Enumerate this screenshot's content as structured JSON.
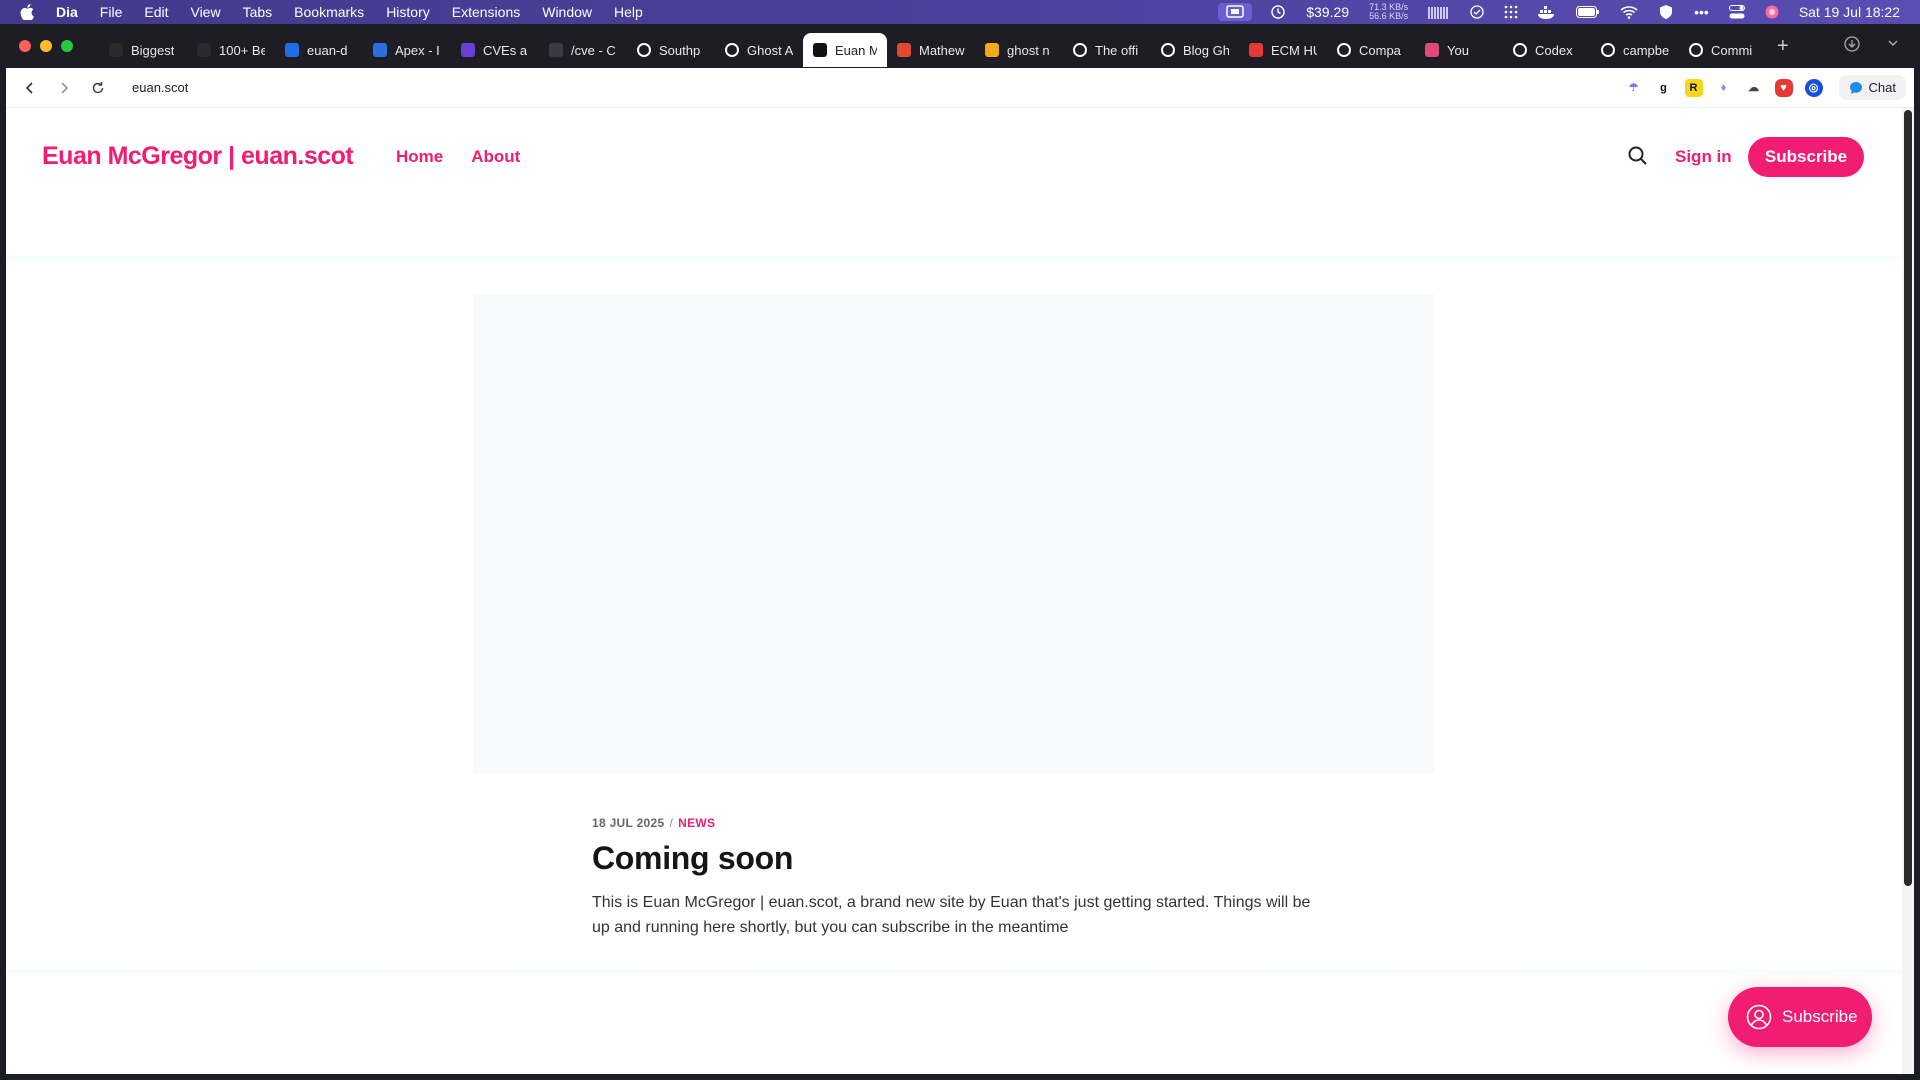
{
  "menubar": {
    "app_name": "Dia",
    "items": [
      "File",
      "Edit",
      "View",
      "Tabs",
      "Bookmarks",
      "History",
      "Extensions",
      "Window",
      "Help"
    ],
    "price": "$39.29",
    "net_up": "71.3 KB/s",
    "net_down": "56.6 KB/s",
    "datetime": "Sat 19 Jul  18:22"
  },
  "tabs": [
    {
      "label": "Biggest",
      "fav_color": "#2b2b2b"
    },
    {
      "label": "100+ Be",
      "fav_color": "#2b2b2b"
    },
    {
      "label": "euan-d",
      "fav_color": "#1e6ee8"
    },
    {
      "label": "Apex - I",
      "fav_color": "#2a6fe0"
    },
    {
      "label": "CVEs a",
      "fav_color": "#6a3fd8"
    },
    {
      "label": "/cve - C",
      "fav_color": "#3a3a44"
    },
    {
      "label": "Southp",
      "fav_color": "#ffffff"
    },
    {
      "label": "Ghost A",
      "fav_color": "#ffffff"
    },
    {
      "label": "Euan M",
      "fav_color": "#111111"
    },
    {
      "label": "Mathew",
      "fav_color": "#e2492f"
    },
    {
      "label": "ghost n",
      "fav_color": "#f2a91b"
    },
    {
      "label": "The offi",
      "fav_color": "#ffffff"
    },
    {
      "label": "Blog Gh",
      "fav_color": "#ffffff"
    },
    {
      "label": "ECM HU",
      "fav_color": "#e53935"
    },
    {
      "label": "Compa",
      "fav_color": "#ffffff"
    },
    {
      "label": "You",
      "fav_color": "#e04a7a"
    },
    {
      "label": "Codex",
      "fav_color": "#ffffff"
    },
    {
      "label": "campbe",
      "fav_color": "#ffffff"
    },
    {
      "label": "Commi",
      "fav_color": "#ffffff"
    }
  ],
  "address": {
    "url": "euan.scot",
    "chat_label": "Chat"
  },
  "site": {
    "title": "Euan McGregor | euan.scot",
    "nav": [
      "Home",
      "About"
    ],
    "signin": "Sign in",
    "subscribe": "Subscribe",
    "accent": "#f01d72"
  },
  "post": {
    "date": "18 JUL 2025",
    "separator": "/",
    "tag": "NEWS",
    "title": "Coming soon",
    "excerpt": "This is Euan McGregor | euan.scot, a brand new site by Euan that's just getting started. Things will be up and running here shortly, but you can subscribe in the meantime"
  },
  "floating_subscribe": "Subscribe"
}
